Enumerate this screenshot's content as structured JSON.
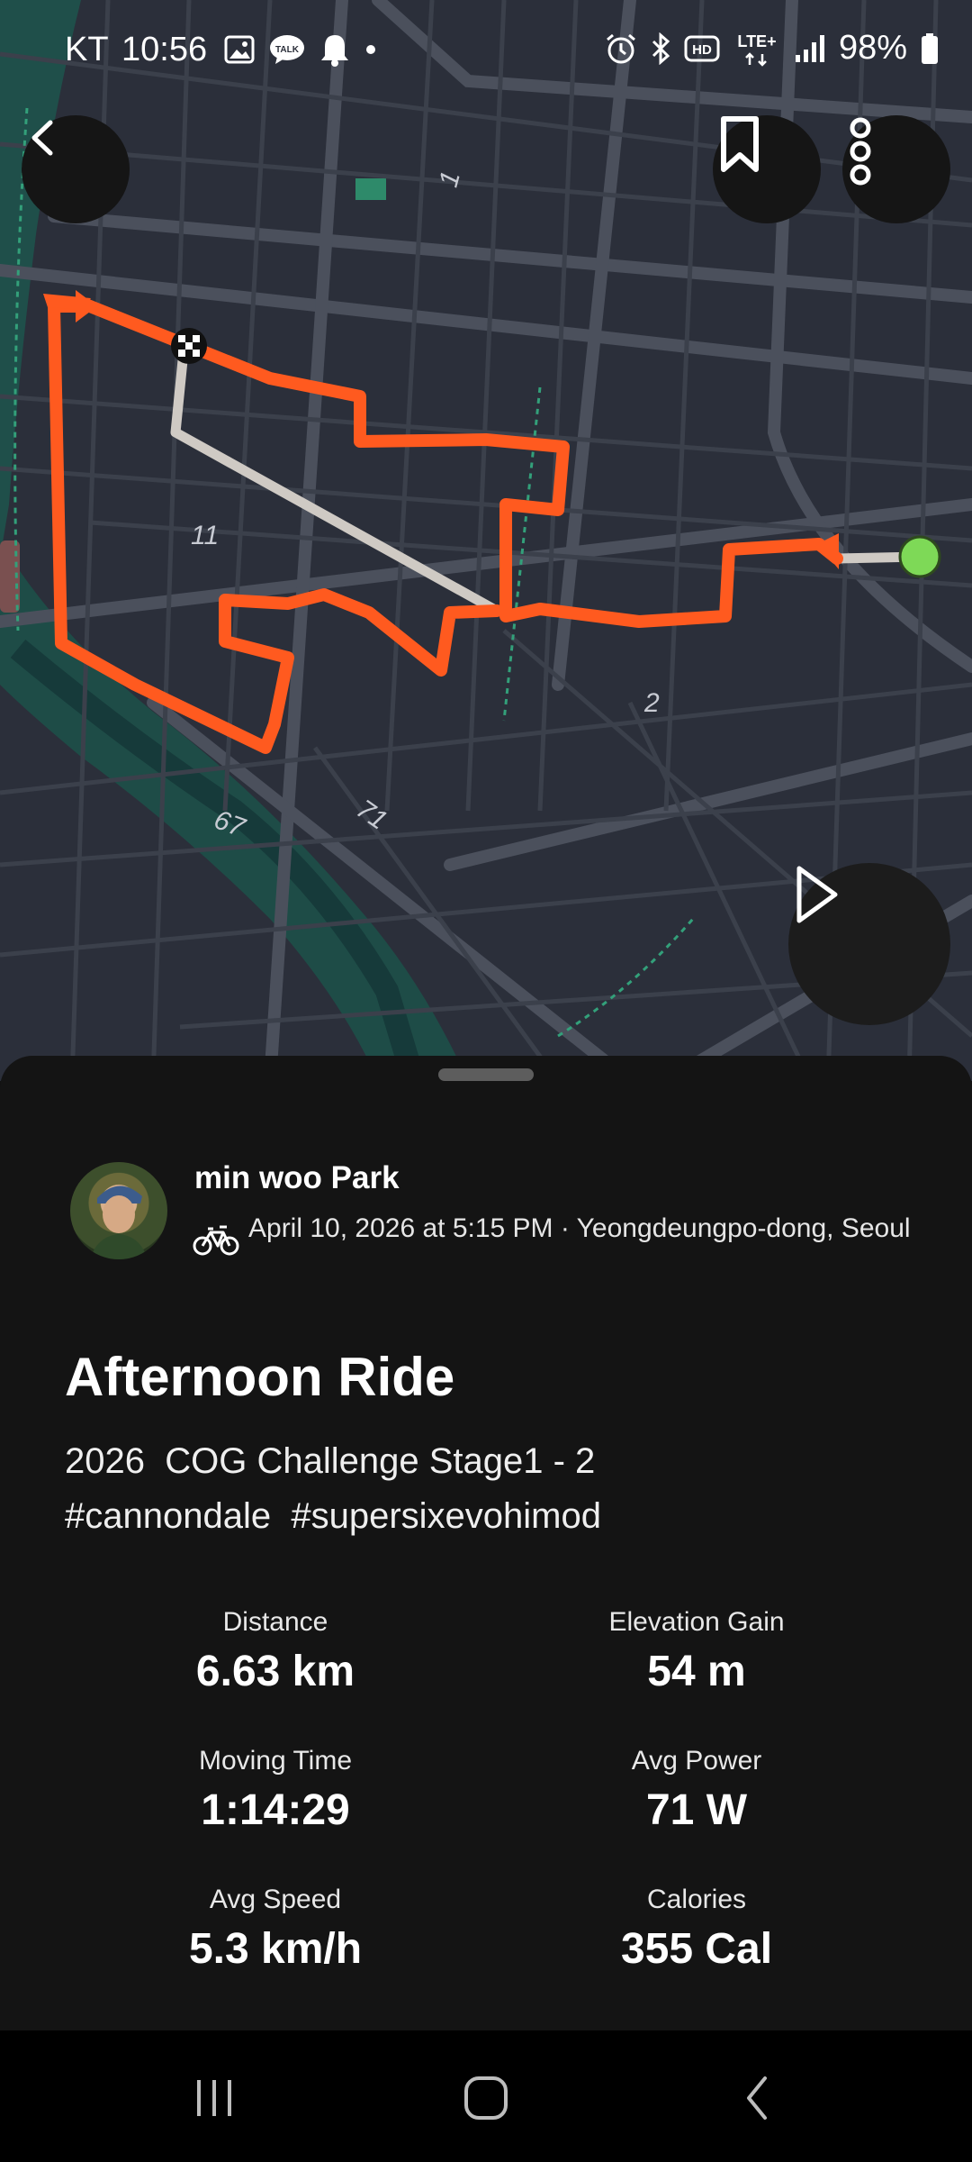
{
  "status_bar": {
    "carrier": "KT",
    "time": "10:56",
    "battery_pct": "98%",
    "icons": [
      "gallery-icon",
      "talk-icon",
      "bell-icon",
      "dot-icon",
      "alarm-icon",
      "bluetooth-icon",
      "hd-icon",
      "lte-icon",
      "signal-icon",
      "battery-icon"
    ],
    "talk_badge": "TALK",
    "hd_badge": "HD",
    "lte_badge": "LTE+"
  },
  "map": {
    "street_labels": [
      "1",
      "11",
      "2",
      "67",
      "71"
    ],
    "route_color": "#ff5a1f",
    "end_marker_color": "#7ed957",
    "buttons": [
      "back-icon",
      "bookmark-icon",
      "more-vertical-icon",
      "play-icon"
    ]
  },
  "activity": {
    "athlete_name": "min woo Park",
    "sport_icon": "bicycle-icon",
    "meta": "April 10, 2026 at 5:15 PM · Yeongdeungpo-dong, Seoul",
    "title": "Afternoon Ride",
    "description_line1": "2026  COG Challenge Stage1 - 2",
    "description_line2": "#cannondale  #supersixevohimod",
    "stats": [
      {
        "label": "Distance",
        "value": "6.63 km"
      },
      {
        "label": "Elevation Gain",
        "value": "54 m"
      },
      {
        "label": "Moving Time",
        "value": "1:14:29"
      },
      {
        "label": "Avg Power",
        "value": "71 W"
      },
      {
        "label": "Avg Speed",
        "value": "5.3 km/h"
      },
      {
        "label": "Calories",
        "value": "355 Cal"
      }
    ]
  },
  "nav_bar": {
    "icons": [
      "recent-apps-icon",
      "home-icon",
      "back-nav-icon"
    ]
  }
}
